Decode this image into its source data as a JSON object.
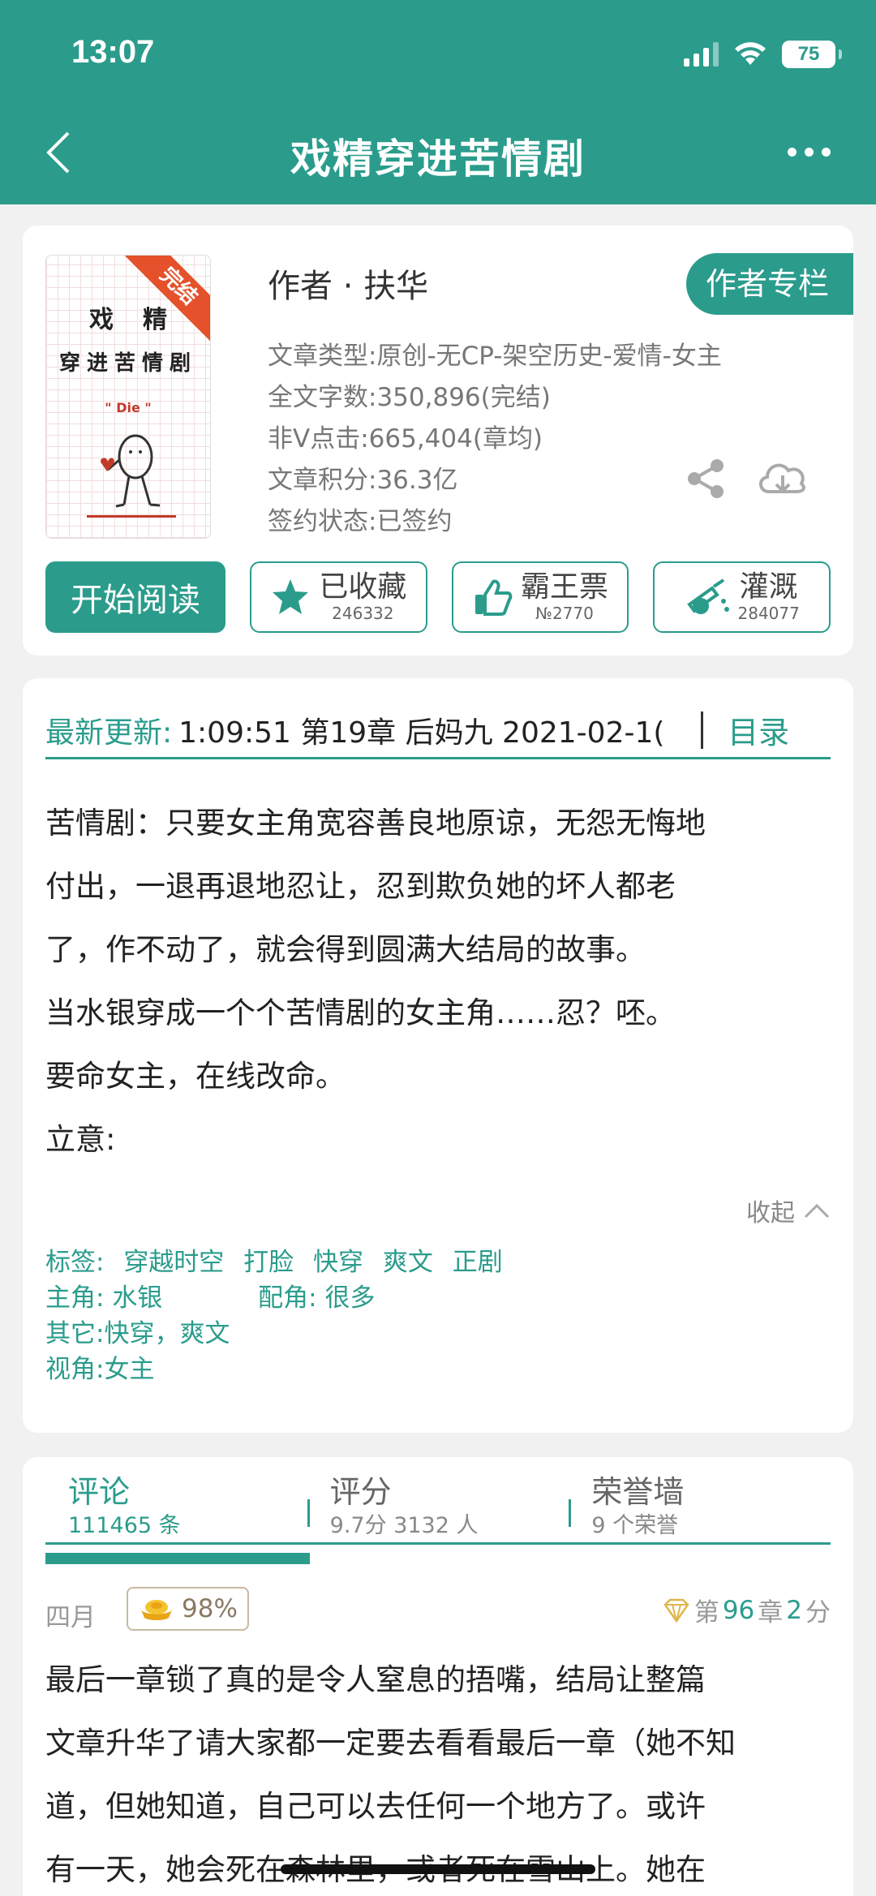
{
  "status": {
    "time": "13:07",
    "battery": "75"
  },
  "header": {
    "title": "戏精穿进苦情剧"
  },
  "book": {
    "cover": {
      "line1": "戏精",
      "line2": "穿进苦情剧",
      "tag": "\" Die \"",
      "ribbon": "完结"
    },
    "author": "作者 · 扶华",
    "author_column": "作者专栏",
    "meta": [
      "文章类型:原创-无CP-架空历史-爱情-女主",
      "全文字数:350,896(完结)",
      "非V点击:665,404(章均)",
      "文章积分:36.3亿",
      "签约状态:已签约"
    ],
    "actions": {
      "read": "开始阅读",
      "collect": {
        "label": "已收藏",
        "count": "246332"
      },
      "vote": {
        "label": "霸王票",
        "count": "№2770"
      },
      "water": {
        "label": "灌溉",
        "count": "284077"
      }
    }
  },
  "update": {
    "label": "最新更新:",
    "text": "1:09:51   第19章 后妈九 2021-02-1(",
    "toc": "目录"
  },
  "intro": [
    "苦情剧：只要女主角宽容善良地原谅，无怨无悔地",
    "付出，一退再退地忍让，忍到欺负她的坏人都老",
    "了，作不动了，就会得到圆满大结局的故事。",
    "当水银穿成一个个苦情剧的女主角……忍？呸。",
    "要命女主，在线改命。",
    "立意:"
  ],
  "collapse": "收起",
  "tags": {
    "tags_label": "标签:",
    "tags": [
      "穿越时空",
      "打脸",
      "快穿",
      "爽文",
      "正剧"
    ],
    "lead_label": "主角:",
    "lead": "水银",
    "support_label": "配角:",
    "support": "很多",
    "other_label": "其它:",
    "other": "快穿，爽文",
    "view_label": "视角:",
    "view": "女主"
  },
  "tabs": [
    {
      "title": "评论",
      "sub": "111465 条"
    },
    {
      "title": "评分",
      "sub": "9.7分 3132 人"
    },
    {
      "title": "荣誉墙",
      "sub": "9 个荣誉"
    }
  ],
  "comment": {
    "month": "四月",
    "badge": "98%",
    "chapter_prefix": "第",
    "chapter_num": "96",
    "chapter_mid": "章",
    "score": "2",
    "score_unit": "分",
    "body": [
      "最后一章锁了真的是令人窒息的捂嘴，结局让整篇",
      "文章升华了请大家都一定要去看看最后一章（她不知",
      "道，但她知道，自己可以去任何一个地方了。或许",
      "有一天，她会死在森林里，或者死在雪山上。她在"
    ]
  },
  "colors": {
    "accent": "#2b9c8c",
    "ribbon": "#e4512b"
  }
}
